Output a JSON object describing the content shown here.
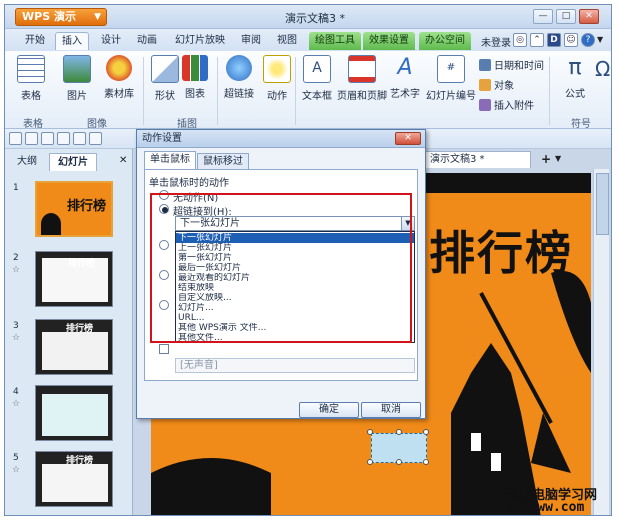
{
  "app": {
    "logo_label": "WPS 演示",
    "document_title": "演示文稿3 *",
    "window_controls": [
      "—",
      "□",
      "✕"
    ]
  },
  "ribbon_tabs": [
    "开始",
    "插入",
    "设计",
    "动画",
    "幻灯片放映",
    "审阅",
    "视图",
    "绘图工具",
    "效果设置",
    "办公空间"
  ],
  "ribbon_active_tab": "插入",
  "ribbon_right": {
    "login_label": "未登录",
    "help_icon": "?"
  },
  "ribbon": {
    "buttons": [
      "表格",
      "图片",
      "素材库",
      "形状",
      "图表",
      "超链接",
      "动作",
      "文本框",
      "页眉和页脚",
      "艺术字",
      "幻灯片编号",
      "公式"
    ],
    "small_items": [
      "日期和时间",
      "对象",
      "插入附件"
    ],
    "group_labels": [
      "表格",
      "图像",
      "插图",
      "符号"
    ]
  },
  "panel": {
    "tabs": [
      "大纲",
      "幻灯片"
    ],
    "close": "✕",
    "slide_numbers": [
      "1",
      "2",
      "3",
      "4",
      "5"
    ],
    "thumb_title": "排行榜"
  },
  "editor": {
    "tab_label": "演示文稿3 *",
    "tab_add": "+",
    "slide_title": "排行榜"
  },
  "dialog": {
    "title": "动作设置",
    "close": "✕",
    "tabs": [
      "单击鼠标",
      "鼠标移过"
    ],
    "section_label": "单击鼠标时的动作",
    "radio_none": "无动作(N)",
    "radio_hyperlink": "超链接到(H):",
    "combo_value": "下一张幻灯片",
    "dropdown_options": [
      "下一张幻灯片",
      "上一张幻灯片",
      "第一张幻灯片",
      "最后一张幻灯片",
      "最近观看的幻灯片",
      "结束放映",
      "自定义放映...",
      "幻灯片...",
      "URL...",
      "其他 WPS演示 文件...",
      "其他文件..."
    ],
    "play_sound_value": "[无声音]",
    "ok": "确定",
    "cancel": "取消"
  },
  "watermark": {
    "line1": "无忧电脑学习网",
    "line2": "wypcww.com"
  },
  "colors": {
    "accent_orange": "#f08a18",
    "ribbon_blue": "#d3e1f3",
    "selection_blue": "#1e5fb6",
    "highlight_red": "#d2141a"
  }
}
